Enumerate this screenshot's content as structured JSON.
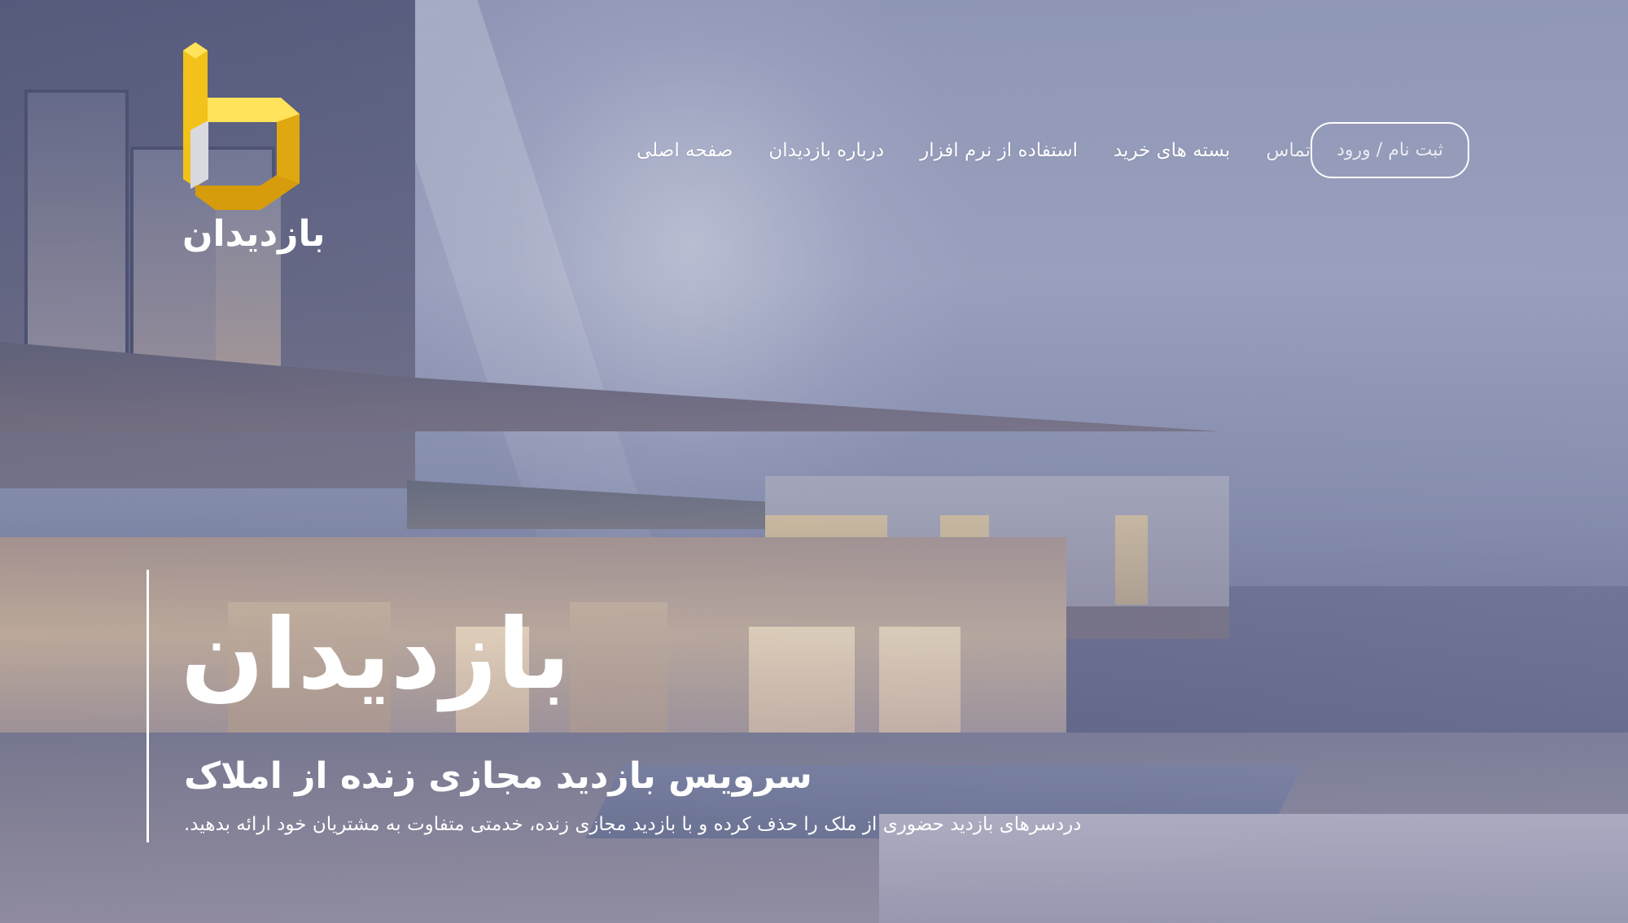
{
  "brand": {
    "logo_text": "بازدیدان",
    "logo_colors": {
      "yellow": "#f7c81e",
      "yellow_dark": "#e0a810",
      "grey": "#d8d8de"
    }
  },
  "nav": {
    "items": [
      {
        "label": "صفحه اصلی"
      },
      {
        "label": "درباره بازدیدان"
      },
      {
        "label": "استفاده از نرم افزار"
      },
      {
        "label": "بسته های خرید"
      },
      {
        "label": "تماس"
      }
    ],
    "auth_button": "ثبت نام / ورود"
  },
  "hero": {
    "title": "بازدیدان",
    "subtitle": "سرویس بازدید مجازی زنده از املاک",
    "description": "دردسرهای بازدید حضوری از ملک را حذف کرده و با بازدید مجازی زنده، خدمتی متفاوت به مشتریان خود ارائه بدهید."
  },
  "colors": {
    "text": "#ffffff",
    "overlay": "#8d95b3"
  }
}
